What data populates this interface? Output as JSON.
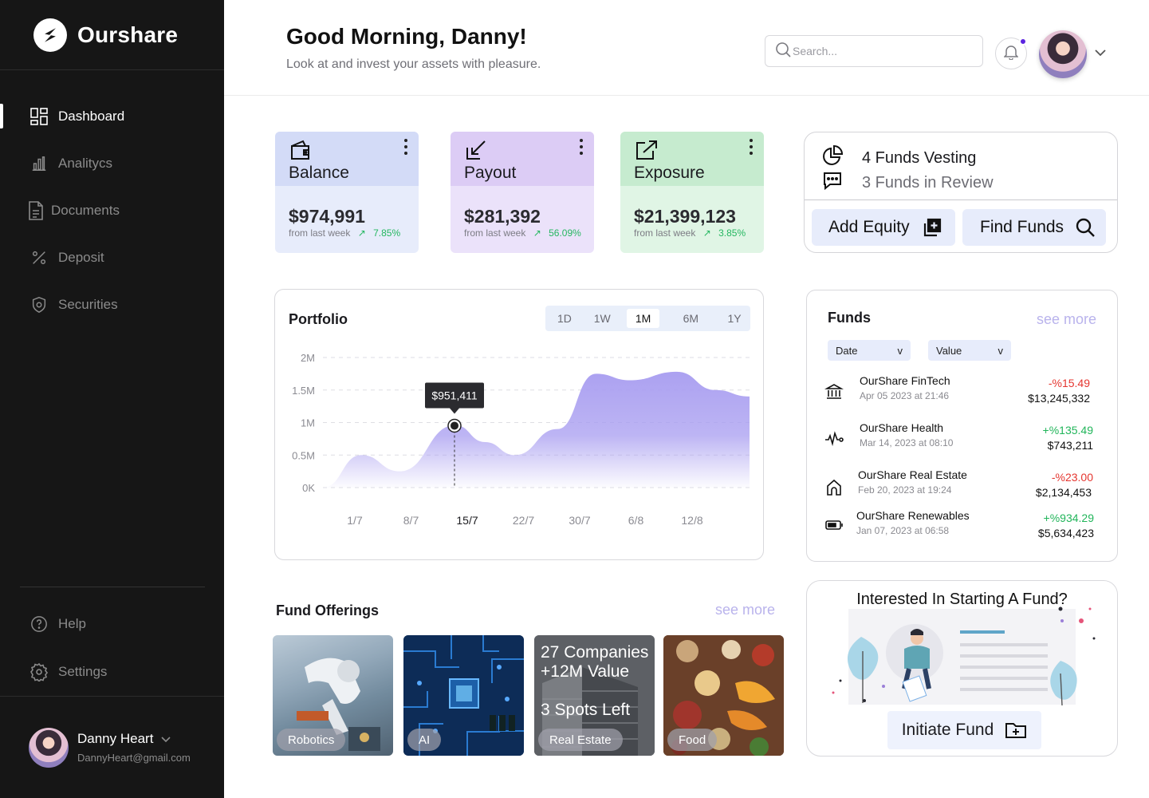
{
  "app": {
    "name": "Ourshare"
  },
  "sidebar": {
    "items": [
      {
        "label": "Dashboard",
        "icon": "dashboard-icon",
        "active": true
      },
      {
        "label": "Analitycs",
        "icon": "bar-chart-icon"
      },
      {
        "label": "Documents",
        "icon": "document-icon"
      },
      {
        "label": "Deposit",
        "icon": "percent-icon"
      },
      {
        "label": "Securities",
        "icon": "shield-icon"
      }
    ],
    "bottom": [
      {
        "label": "Help",
        "icon": "help-icon"
      },
      {
        "label": "Settings",
        "icon": "gear-icon"
      }
    ],
    "profile": {
      "name": "Danny Heart",
      "email": "DannyHeart@gmail.com"
    }
  },
  "header": {
    "greeting": "Good Morning, Danny!",
    "subtitle": "Look at and invest your assets with pleasure.",
    "search_placeholder": "Search..."
  },
  "stats": [
    {
      "title": "Balance",
      "value": "$974,991",
      "sub": "from last week",
      "change": "7.85%",
      "color": "#d3dbf7",
      "body": "#e7ecfb",
      "icon": "wallet-icon"
    },
    {
      "title": "Payout",
      "value": "$281,392",
      "sub": "from last week",
      "change": "56.09%",
      "color": "#dcccf5",
      "body": "#ebe2fa",
      "icon": "arrow-down-left-icon"
    },
    {
      "title": "Exposure",
      "value": "$21,399,123",
      "sub": "from last week",
      "change": "3.85%",
      "color": "#c6ebcf",
      "body": "#e0f5e5",
      "icon": "external-link-icon"
    }
  ],
  "vesting": {
    "line1": "4 Funds Vesting",
    "line2": "3 Funds in Review",
    "add_equity": "Add Equity",
    "find_funds": "Find Funds"
  },
  "portfolio": {
    "title": "Portfolio",
    "ranges": [
      "1D",
      "1W",
      "1M",
      "6M",
      "1Y"
    ],
    "active_range": "1M",
    "tooltip": "$951,411"
  },
  "chart_data": {
    "type": "area",
    "title": "Portfolio",
    "x_ticks": [
      "1/7",
      "8/7",
      "15/7",
      "22/7",
      "30/7",
      "6/8",
      "12/8"
    ],
    "y_ticks": [
      "2M",
      "1.5M",
      "1M",
      "0.5M",
      "0K"
    ],
    "ylim": [
      0,
      2000000
    ],
    "highlighted_x": "15/7",
    "highlighted_value": 951411,
    "grid": true,
    "series": [
      {
        "color": "#a79cf0",
        "x": [
          0,
          0.09,
          0.18,
          0.31,
          0.38,
          0.45,
          0.55,
          0.64,
          0.72,
          0.83,
          0.92,
          1.0
        ],
        "values": [
          0,
          500000,
          250000,
          960000,
          700000,
          500000,
          900000,
          1750000,
          1650000,
          1780000,
          1500000,
          1400000
        ]
      }
    ]
  },
  "funds": {
    "title": "Funds",
    "see_more": "see more",
    "filters": [
      "Date",
      "Value"
    ],
    "items": [
      {
        "name": "OurShare FinTech",
        "date": "Apr 05 2023 at 21:46",
        "change": "-%15.49",
        "value": "$13,245,332",
        "positive": false,
        "icon": "bank-icon"
      },
      {
        "name": "OurShare Health",
        "date": "Mar 14, 2023 at 08:10",
        "change": "+%135.49",
        "value": "$743,211",
        "positive": true,
        "icon": "heartbeat-icon"
      },
      {
        "name": "OurShare Real Estate",
        "date": "Feb 20, 2023 at 19:24",
        "change": "-%23.00",
        "value": "$2,134,453",
        "positive": false,
        "icon": "home-icon"
      },
      {
        "name": "OurShare Renewables",
        "date": "Jan 07, 2023 at 06:58",
        "change": "+%934.29",
        "value": "$5,634,423",
        "positive": true,
        "icon": "battery-icon"
      }
    ]
  },
  "offerings": {
    "title": "Fund Offerings",
    "see_more": "see more",
    "tiles": [
      {
        "label": "Robotics"
      },
      {
        "label": "AI"
      },
      {
        "label": "Real Estate",
        "line1": "27 Companies",
        "line2": "+12M Value",
        "line3": "3 Spots Left"
      },
      {
        "label": "Food"
      }
    ]
  },
  "start_fund": {
    "title": "Interested In Starting A Fund?",
    "button": "Initiate Fund"
  }
}
